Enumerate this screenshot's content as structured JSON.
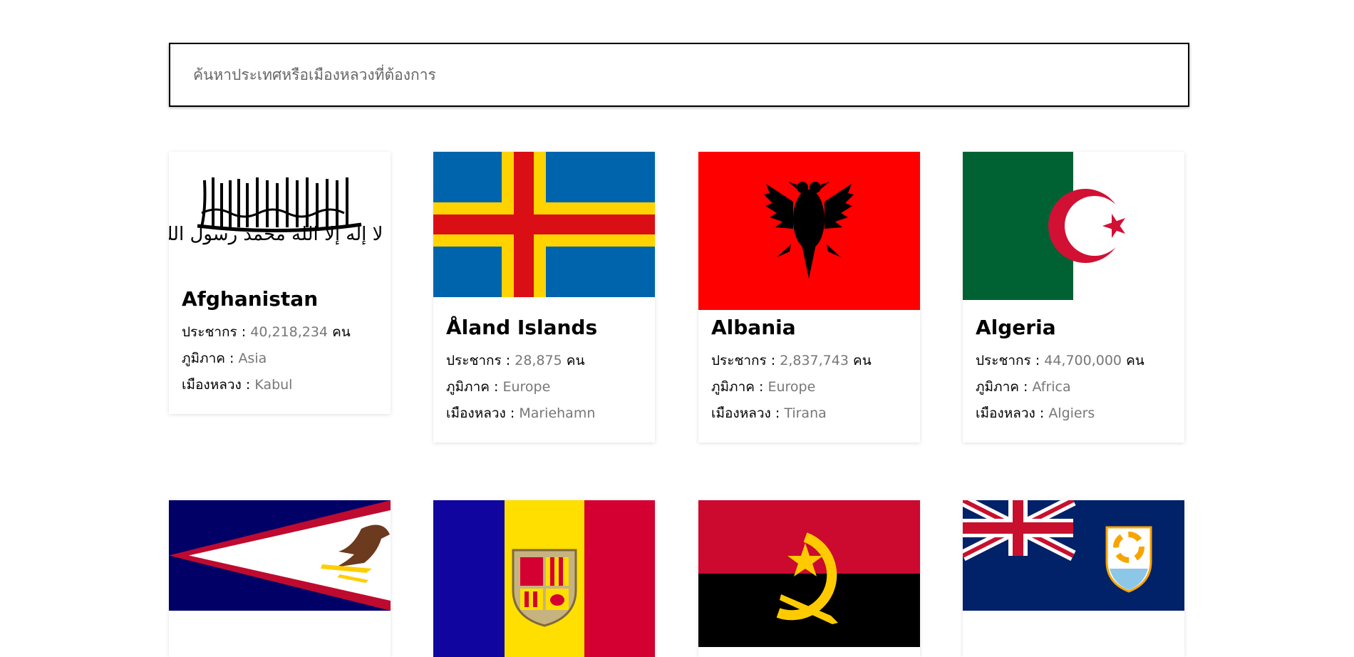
{
  "search": {
    "placeholder": "ค้นหาประเทศหรือเมืองหลวงที่ต้องการ"
  },
  "labels": {
    "population": "ประชากร",
    "region": "ภูมิภาค",
    "capital": "เมืองหลวง",
    "separator": " : ",
    "people_unit": "คน"
  },
  "countries": [
    {
      "name": "Afghanistan",
      "population": "40,218,234",
      "region": "Asia",
      "capital": "Kabul",
      "flag_icon": "flag-afghanistan-icon",
      "flag_inscription": "لا إله إلا الله محمد رسول الله"
    },
    {
      "name": "Åland Islands",
      "population": "28,875",
      "region": "Europe",
      "capital": "Mariehamn",
      "flag_icon": "flag-aland-islands-icon"
    },
    {
      "name": "Albania",
      "population": "2,837,743",
      "region": "Europe",
      "capital": "Tirana",
      "flag_icon": "flag-albania-icon"
    },
    {
      "name": "Algeria",
      "population": "44,700,000",
      "region": "Africa",
      "capital": "Algiers",
      "flag_icon": "flag-algeria-icon"
    },
    {
      "flag_icon": "flag-american-samoa-icon"
    },
    {
      "flag_icon": "flag-andorra-icon"
    },
    {
      "flag_icon": "flag-angola-icon"
    },
    {
      "flag_icon": "flag-anguilla-icon"
    }
  ],
  "colors": {
    "card_value_text": "#777777",
    "search_border": "#000000",
    "aland_blue": "#0064AD",
    "aland_yellow": "#FFD300",
    "aland_red": "#DA0E15",
    "albania_red": "#FF0000",
    "algeria_green": "#006233",
    "algeria_red": "#D21034",
    "samoa_blue": "#000066",
    "samoa_red": "#BF0A30",
    "andorra_blue": "#10069F",
    "andorra_yellow": "#FEDF00",
    "andorra_red": "#D50032",
    "angola_red": "#CC092F",
    "angola_yellow": "#FFCB00",
    "anguilla_blue": "#012169",
    "anguilla_orange": "#F7A400"
  }
}
